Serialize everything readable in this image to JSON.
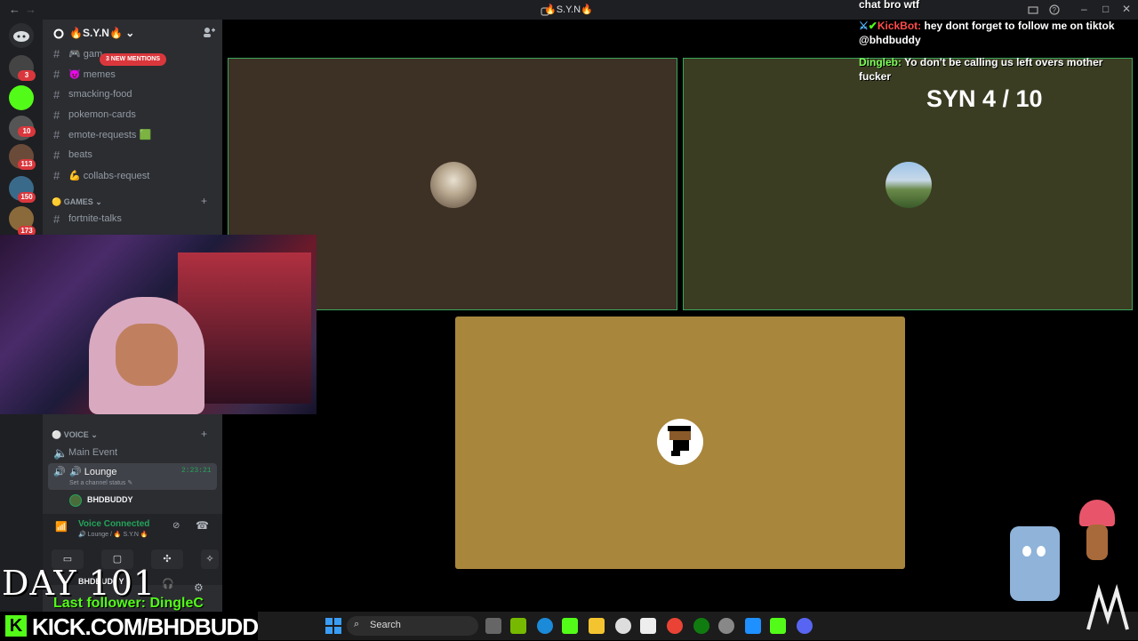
{
  "window": {
    "title": "🔥S.Y.N🔥",
    "back": "←",
    "forward": "→"
  },
  "server": {
    "name": "🔥S.Y.N🔥",
    "new_mentions": "3 NEW MENTIONS",
    "channels": [
      {
        "label": "🎮 gam"
      },
      {
        "label": "😈 memes"
      },
      {
        "label": "smacking-food"
      },
      {
        "label": "pokemon-cards"
      },
      {
        "label": "emote-requests 🟩"
      },
      {
        "label": "beats"
      },
      {
        "label": "💪 collabs-request"
      }
    ],
    "categories": {
      "games": "🟡 GAMES ⌄",
      "voice": "⚪ VOICE ⌄"
    },
    "games_channels": [
      {
        "label": "fortnite-talks"
      }
    ],
    "voice_channels": {
      "main_event": "Main Event",
      "lounge": "🔊 Lounge",
      "lounge_timer": "2:23:21",
      "lounge_status": "Set a channel status ✎",
      "member": "BHDBUDDY"
    }
  },
  "server_badges": [
    "3",
    "10",
    "113",
    "150",
    "173"
  ],
  "voice_panel": {
    "status": "Voice Connected",
    "channel": "🔊 Lounge / 🔥 S.Y.N 🔥",
    "user": "BHDBUDDY"
  },
  "chat": {
    "line0": "chat bro wtf",
    "msg1_user": "KickBot:",
    "msg1_text": " hey dont forget to follow me on tiktok",
    "msg1_text2": "@bhdbuddy",
    "msg2_user": "Dingleb:",
    "msg2_text": " Yo don't be calling us left overs mother",
    "msg2_text2": "fucker"
  },
  "stage": {
    "counter": "SYN 4 / 10"
  },
  "overlay": {
    "day": "DAY 101",
    "last_follower": "Last follower: DingleC",
    "kick_url": "KICK.COM/BHDBUDDY",
    "kick_logo": "K"
  },
  "taskbar": {
    "search_label": "Search"
  },
  "colors": {
    "discord_green": "#23a55a",
    "mention_red": "#da373c",
    "kick_green": "#53fc18",
    "tile1": "#3d3024",
    "tile2": "#3a3d22",
    "tile3": "#a8863c"
  }
}
